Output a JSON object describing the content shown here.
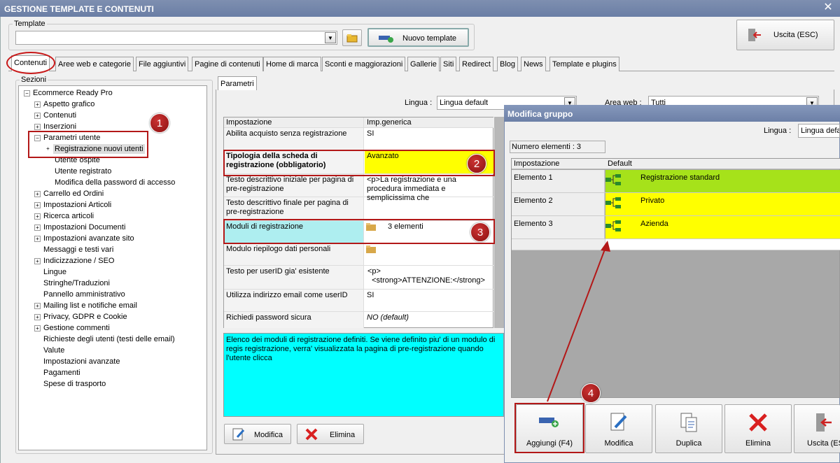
{
  "window": {
    "title": "GESTIONE TEMPLATE E CONTENUTI",
    "close": "✕"
  },
  "template_group": {
    "label": "Template",
    "value": "",
    "new_button": "Nuovo template"
  },
  "exit_button": "Uscita (ESC)",
  "tabs": [
    "Contenuti",
    "Aree web e categorie",
    "File aggiuntivi",
    "Pagine di contenuti",
    "Home di marca",
    "Sconti e maggiorazioni",
    "Gallerie",
    "Siti",
    "Redirect",
    "Blog",
    "News",
    "Template e plugins"
  ],
  "sections": {
    "label": "Sezioni",
    "root": "Ecommerce Ready Pro",
    "items": [
      "Aspetto grafico",
      "Contenuti",
      "Inserzioni",
      "Parametri utente",
      "Registrazione nuovi utenti",
      "Utente ospite",
      "Utente registrato",
      "Modifica della password di accesso",
      "Carrello ed Ordini",
      "Impostazioni Articoli",
      "Ricerca articoli",
      "Impostazioni Documenti",
      "Impostazioni avanzate sito",
      "Messaggi e testi vari",
      "Indicizzazione / SEO",
      "Lingue",
      "Stringhe/Traduzioni",
      "Pannello amministrativo",
      "Mailing list e notifiche email",
      "Privacy, GDPR e Cookie",
      "Gestione commenti",
      "Richieste degli utenti (testi delle email)",
      "Valute",
      "Impostazioni avanzate",
      "Pagamenti",
      "Spese di trasporto"
    ]
  },
  "params": {
    "tab": "Parametri",
    "lingua_label": "Lingua :",
    "lingua_value": "Lingua default",
    "area_label": "Area web :",
    "area_value": "Tutti",
    "col1": "Impostazione",
    "col2": "Imp.generica",
    "rows": [
      {
        "name": "Abilita acquisto senza registrazione",
        "value": "SI"
      },
      {
        "name": "Tipologia della scheda di registrazione (obbligatorio)",
        "value": "Avanzato"
      },
      {
        "name": "Testo descrittivo iniziale per pagina di pre-registrazione",
        "value": "<p>La registrazione e una procedura immediata e semplicissima che"
      },
      {
        "name": "Testo descrittivo finale per pagina di pre-registrazione",
        "value": ""
      },
      {
        "name": "Moduli di registrazione",
        "value": "3 elementi"
      },
      {
        "name": "Modulo riepilogo dati personali",
        "value": ""
      },
      {
        "name": "Testo per userID gia' esistente",
        "value": "<p>\n  <strong>ATTENZIONE:</strong>"
      },
      {
        "name": "Utilizza indirizzo email come userID",
        "value": "SI"
      },
      {
        "name": "Richiedi password sicura",
        "value": "NO (default)"
      }
    ],
    "description": "Elenco dei moduli di registrazione definiti. Se viene definito piu' di un modulo di regis registrazione, verra' visualizzata la pagina di pre-registrazione quando l'utente clicca",
    "modifica": "Modifica",
    "elimina": "Elimina"
  },
  "dialog": {
    "title": "Modifica gruppo",
    "lingua_label": "Lingua :",
    "lingua_value": "Lingua defa",
    "count": "Numero elementi : 3",
    "col1": "Impostazione",
    "col2": "Default",
    "rows": [
      {
        "name": "Elemento 1",
        "value": "Registrazione standard",
        "color": "#a6e21a"
      },
      {
        "name": "Elemento 2",
        "value": "Privato",
        "color": "#ffff00"
      },
      {
        "name": "Elemento 3",
        "value": "Azienda",
        "color": "#ffff00"
      }
    ],
    "buttons": [
      "Aggiungi (F4)",
      "Modifica",
      "Duplica",
      "Elimina",
      "Uscita (ESC"
    ]
  },
  "callouts": [
    "1",
    "2",
    "3",
    "4"
  ]
}
